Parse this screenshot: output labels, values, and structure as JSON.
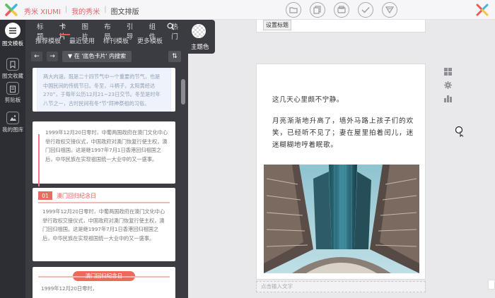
{
  "topbar": {
    "breadcrumbs": [
      "秀米 XIUMI",
      "我的秀米",
      "图文排版"
    ],
    "separator": "|",
    "toolbar_icons": [
      "folder-icon",
      "copy-icon",
      "save-icon",
      "check-icon",
      "send-icon"
    ]
  },
  "rail": {
    "items": [
      {
        "label": "图文模板",
        "icon": "menu-icon"
      },
      {
        "label": "图文收藏",
        "icon": "bookmark-icon"
      },
      {
        "label": "剪贴板",
        "icon": "clipboard-icon"
      },
      {
        "label": "我的图库",
        "icon": "image-icon"
      }
    ]
  },
  "panel": {
    "tabs": [
      "标题",
      "卡片",
      "图片",
      "布局",
      "引导",
      "组件",
      "热门"
    ],
    "active_tab": "卡片",
    "subtabs": [
      "推荐模板",
      "最近使用",
      "样刊模板",
      "更多模板"
    ],
    "theme_label": "主题色",
    "back_arrow": "←",
    "forward_arrow": "→",
    "filter_text": "在 '底色卡片' 内搜索",
    "sort_symbol": "⇅"
  },
  "cards": {
    "card1_text": "两大内涵，既是二十四节气中一个重要的节气，也是中国民间的传统节日。冬至，斗柄子，太阳黄经达270°，于每年公历12月21~23日交节。冬至是时年八节之一，古时民间有冬\"节\"拜神祭祖的习俗。",
    "card2_text": "1999年12月20日零时，中葡两国政府在澳门文化中心举行政权交接仪式，中国政府对澳门恢复行使主权，澳门回归祖国。这是继1997年7月1日香港回归祖国之后，中华民族在实现祖国统一大业中的又一盛事。",
    "card3_num": "01",
    "card3_title": "澳门回归纪念日",
    "card3_text": "1999年12月20日零时，中葡两国政府在澳门文化中心举行政权交接仪式，中国政府对澳门恢复行使主权，澳门回归祖国。这是继1997年7月1日香港回归祖国之后，中华民族在实现祖国统一大业中的又一盛事。",
    "card4_title": "澳门回归纪念日",
    "card4_text": "1999年12月20日零时，"
  },
  "editor": {
    "prev_tag": "设置标题",
    "line1": "这几天心里颇不宁静。",
    "para2": "月亮渐渐地升高了，墙外马路上孩子们的欢笑，已经听不见了；妻在屋里拍着闰儿，迷迷糊糊地哼着眠歌。",
    "caption_placeholder": "点击输入文字",
    "right_tools": [
      "grid-icon",
      "gear-icon",
      "bar-chart-icon"
    ]
  }
}
